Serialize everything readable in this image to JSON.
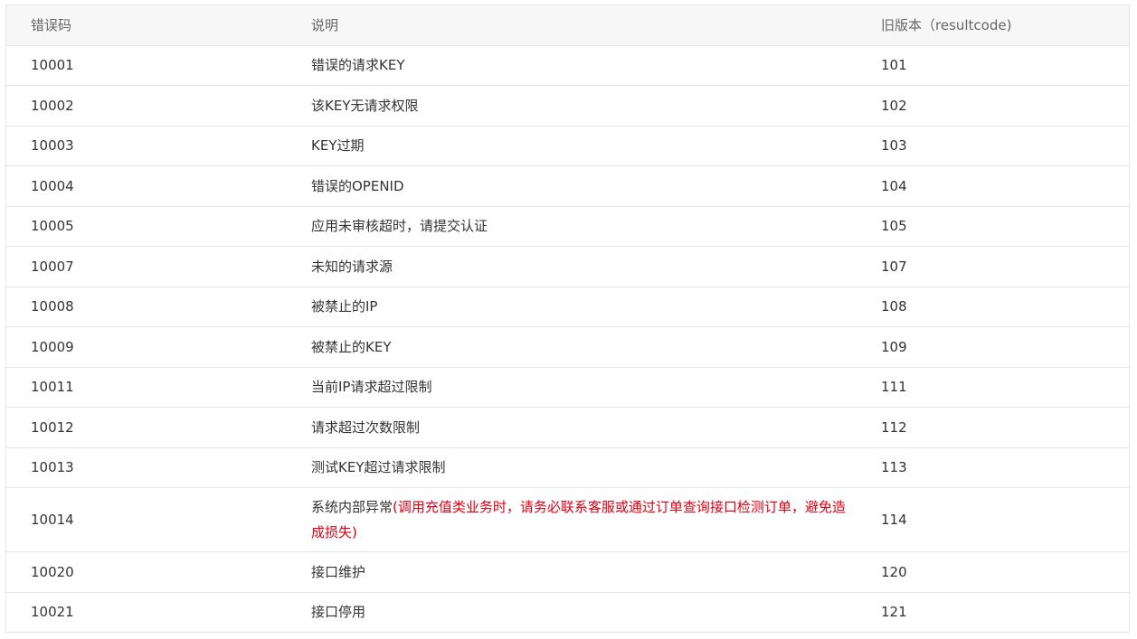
{
  "table": {
    "headers": [
      "错误码",
      "说明",
      "旧版本（resultcode)"
    ],
    "rows": [
      {
        "code": "10001",
        "desc": "错误的请求KEY",
        "desc_warn": "",
        "old": "101"
      },
      {
        "code": "10002",
        "desc": "该KEY无请求权限",
        "desc_warn": "",
        "old": "102"
      },
      {
        "code": "10003",
        "desc": "KEY过期",
        "desc_warn": "",
        "old": "103"
      },
      {
        "code": "10004",
        "desc": "错误的OPENID",
        "desc_warn": "",
        "old": "104"
      },
      {
        "code": "10005",
        "desc": "应用未审核超时，请提交认证",
        "desc_warn": "",
        "old": "105"
      },
      {
        "code": "10007",
        "desc": "未知的请求源",
        "desc_warn": "",
        "old": "107"
      },
      {
        "code": "10008",
        "desc": "被禁止的IP",
        "desc_warn": "",
        "old": "108"
      },
      {
        "code": "10009",
        "desc": "被禁止的KEY",
        "desc_warn": "",
        "old": "109"
      },
      {
        "code": "10011",
        "desc": "当前IP请求超过限制",
        "desc_warn": "",
        "old": "111"
      },
      {
        "code": "10012",
        "desc": "请求超过次数限制",
        "desc_warn": "",
        "old": "112"
      },
      {
        "code": "10013",
        "desc": "测试KEY超过请求限制",
        "desc_warn": "",
        "old": "113"
      },
      {
        "code": "10014",
        "desc": "系统内部异常",
        "desc_warn": "(调用充值类业务时，请务必联系客服或通过订单查询接口检测订单，避免造成损失)",
        "old": "114"
      },
      {
        "code": "10020",
        "desc": "接口维护",
        "desc_warn": "",
        "old": "120"
      },
      {
        "code": "10021",
        "desc": "接口停用",
        "desc_warn": "",
        "old": "121"
      }
    ]
  },
  "colors": {
    "warning": "#e60012",
    "header_bg": "#f7f7f7",
    "border": "#e6e6e6"
  }
}
